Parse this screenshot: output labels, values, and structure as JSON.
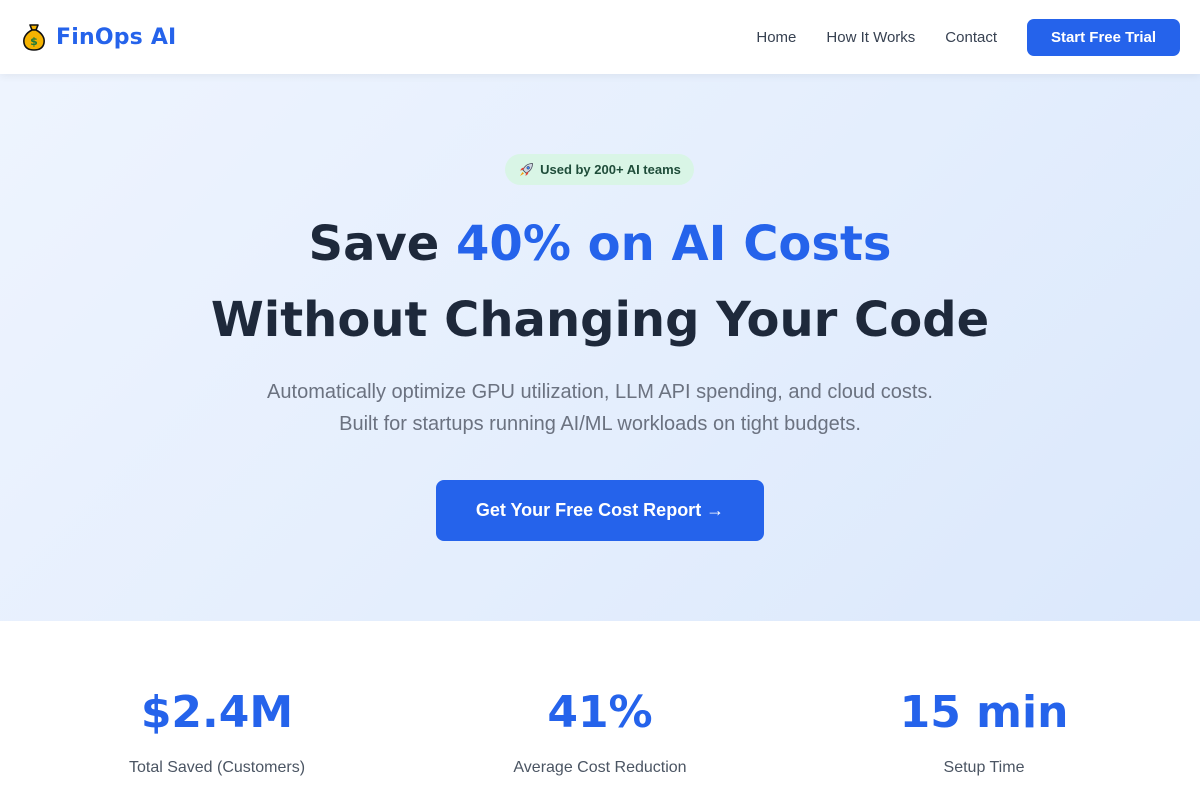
{
  "nav": {
    "brand_name": "FinOps AI",
    "brand_icon": "money-bag-icon",
    "links": [
      "Home",
      "How It Works",
      "Contact"
    ],
    "cta_label": "Start Free Trial"
  },
  "hero": {
    "badge_icon": "rocket-icon",
    "badge_text": "Used by 200+ AI teams",
    "headline_prefix": "Save ",
    "headline_accent": "40% on AI Costs",
    "headline_line2": "Without Changing Your Code",
    "subtitle_line1": "Automatically optimize GPU utilization, LLM API spending, and cloud costs.",
    "subtitle_line2": "Built for startups running AI/ML workloads on tight budgets.",
    "cta_label": "Get Your Free Cost Report →"
  },
  "stats": [
    {
      "value": "$2.4M",
      "label": "Total Saved (Customers)"
    },
    {
      "value": "41%",
      "label": "Average Cost Reduction"
    },
    {
      "value": "15 min",
      "label": "Setup Time"
    }
  ],
  "colors": {
    "accent": "#2563eb",
    "heading": "#1e293b",
    "badge_bg": "#d9f5e6",
    "hero_bg": "#e4eefd"
  }
}
